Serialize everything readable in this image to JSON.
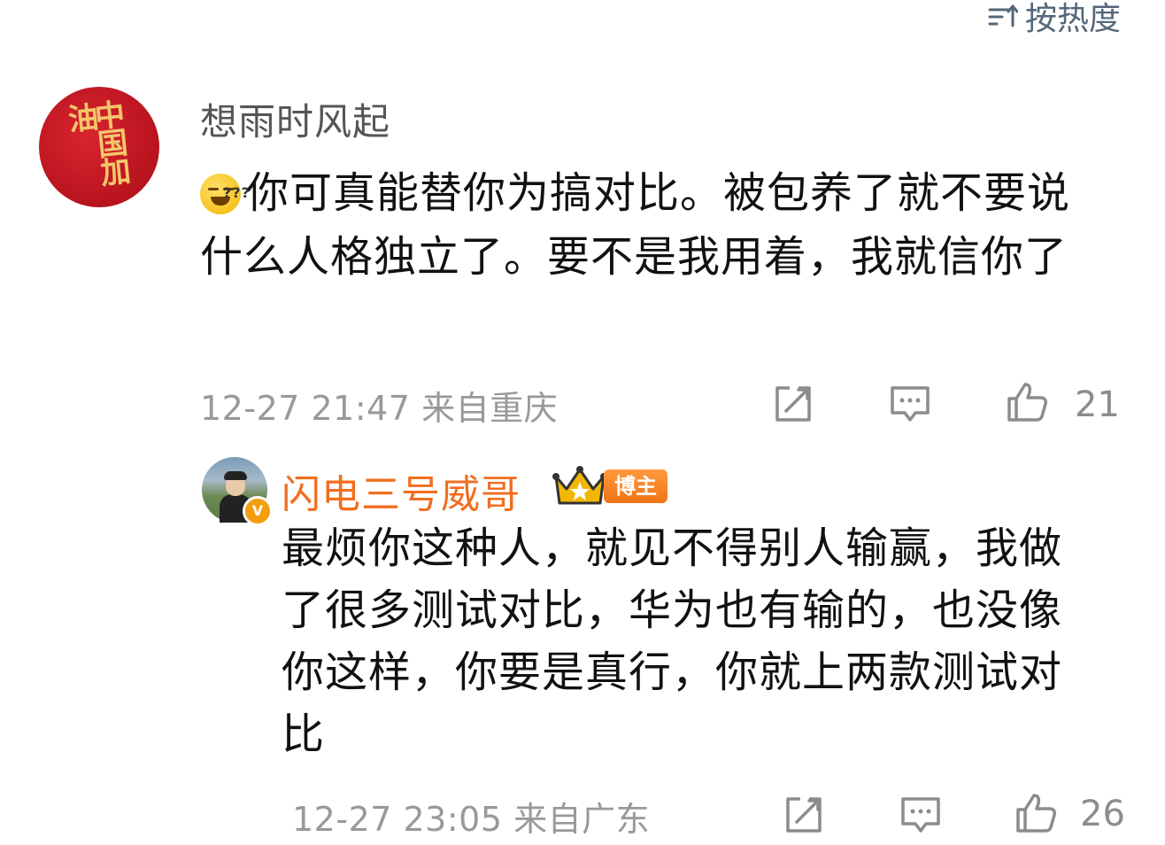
{
  "sort": {
    "label": "按热度",
    "icon": "sort-icon"
  },
  "comment": {
    "avatar": {
      "text": "中国加油",
      "bg_color": "#c41a24",
      "text_color": "#f4c66a"
    },
    "username": "想雨时风起",
    "emoji": "thinking-grin-emoji",
    "text": "你可真能替你为搞对比。被包养了就不要说什么人格独立了。要不是我用着，我就信你了",
    "time": "12-27 21:47",
    "location": "来自重庆",
    "like_count": "21"
  },
  "reply": {
    "username": "闪电三号威哥",
    "username_color": "#f06e1f",
    "badge": "博主",
    "verified_icon": "v-verified-icon",
    "text": "最烦你这种人，就见不得别人输赢，我做了很多测试对比，华为也有输的，也没像你这样，你要是真行，你就上两款测试对比",
    "time": "12-27 23:05",
    "location": "来自广东",
    "like_count": "26"
  }
}
